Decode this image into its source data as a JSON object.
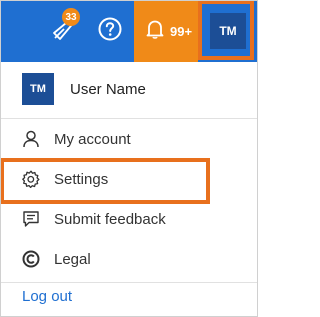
{
  "topbar": {
    "rocket_badge": "33",
    "help_icon": "question-circle-icon",
    "notification_count": "99+",
    "user_initials": "TM"
  },
  "menu": {
    "user_initials": "TM",
    "user_name": "User Name",
    "items": [
      {
        "label": "My account",
        "icon": "person-icon"
      },
      {
        "label": "Settings",
        "icon": "gear-icon"
      },
      {
        "label": "Submit feedback",
        "icon": "feedback-icon"
      },
      {
        "label": "Legal",
        "icon": "copyright-icon"
      }
    ],
    "logout_label": "Log out"
  },
  "colors": {
    "topbar": "#1f6fd1",
    "notification": "#f08a18",
    "avatar": "#1c4e96",
    "highlight": "#e8701d",
    "link": "#1f6fd1"
  }
}
